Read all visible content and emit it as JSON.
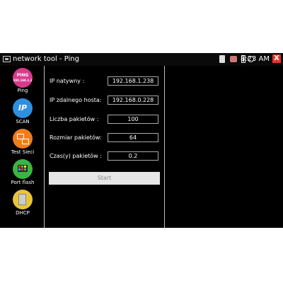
{
  "window": {
    "title": "network tool - Ping",
    "time": "8:23 AM",
    "close_label": "X"
  },
  "sidebar": {
    "items": [
      {
        "label": "Ping",
        "icon": "ping-icon",
        "icon_text_top": "PING",
        "icon_text_bottom": "192.168.1.1"
      },
      {
        "label": "SCAN",
        "icon": "scan-icon",
        "icon_text": "IP"
      },
      {
        "label": "Test Sieci",
        "icon": "network-test-icon"
      },
      {
        "label": "Port flash",
        "icon": "port-flash-icon"
      },
      {
        "label": "DHCP",
        "icon": "dhcp-icon"
      }
    ]
  },
  "form": {
    "fields": [
      {
        "label": "IP natywny :",
        "value": "192.168.1.238"
      },
      {
        "label": "IP zdalnego hosta:",
        "value": "192.168.0.228"
      },
      {
        "label": "Liczba pakietów :",
        "value": "100"
      },
      {
        "label": "Rozmiar pakietów:",
        "value": "64"
      },
      {
        "label": "Czas(y) pakietów :",
        "value": "0.2"
      }
    ],
    "start_label": "Start"
  },
  "colors": {
    "background": "#000000",
    "ping": "#d83a8e",
    "scan": "#2f8fe0",
    "test": "#f07c1a",
    "port": "#3ab540",
    "dhcp": "#e8c43a",
    "close": "#e8302a"
  }
}
